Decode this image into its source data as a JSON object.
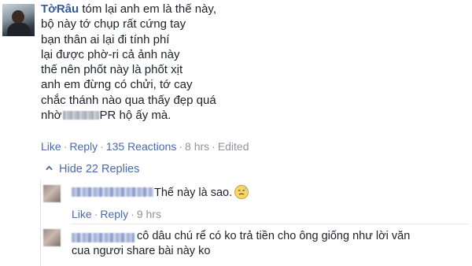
{
  "main_comment": {
    "author": "TờRâu",
    "first_line": "tóm lại anh em là thế này,",
    "lines": [
      "bộ này tớ chụp rất cứng tay",
      "bạn thân ai lại đi tính phí",
      "lại được phờ-ri cả ảnh này",
      "thế nên phốt này là phốt xịt",
      "anh em đừng có chửi, tớ cay",
      "chắc thánh nào qua thấy đẹp quá"
    ],
    "last_line_prefix": "nhờ",
    "last_line_suffix": "PR hộ ấy mà.",
    "actions": {
      "like": "Like",
      "reply": "Reply",
      "reactions": "135 Reactions",
      "time": "8 hrs",
      "edited": "Edited",
      "separator": "·"
    }
  },
  "replies_toggle": {
    "label": "Hide 22 Replies",
    "icon": "chevron-up-icon"
  },
  "replies": [
    {
      "text": "Thế này là sao.",
      "emoji": "sweat-smile-emoji",
      "actions": {
        "like": "Like",
        "reply": "Reply",
        "time": "9 hrs"
      }
    },
    {
      "text_line1": "cô dâu chú rể có ko trả tiền cho ông giống như lời văn",
      "text_line2": "cua ngươi share bài này ko"
    }
  ],
  "colors": {
    "link": "#4b6aa8",
    "author": "#365899",
    "meta": "#90949c",
    "text": "#1d2129"
  }
}
